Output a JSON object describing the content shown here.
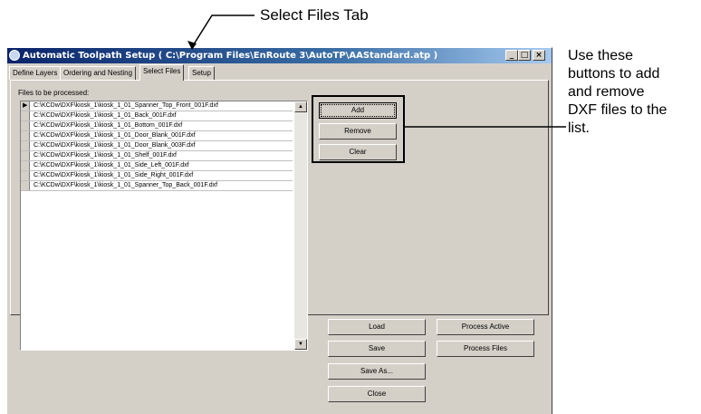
{
  "annotations": {
    "select_files_tab": "Select Files Tab",
    "buttons_note_lines": [
      "Use these",
      "buttons to add",
      "and remove",
      "DXF files to the",
      "list."
    ]
  },
  "window": {
    "title": "Automatic Toolpath Setup ( C:\\Program Files\\EnRoute 3\\AutoTP\\AAStandard.atp )",
    "controls": {
      "minimize": "_",
      "maximize": "□",
      "close": "×"
    }
  },
  "tabs": [
    {
      "label": "Define Layers",
      "active": false
    },
    {
      "label": "Ordering and Nesting",
      "active": false
    },
    {
      "label": "Select Files",
      "active": true
    },
    {
      "label": "Setup",
      "active": false
    }
  ],
  "files_label": "Files to be processed:",
  "files": [
    "C:\\KCDw\\DXF\\kiosk_1\\kiosk_1_01_Spanner_Top_Front_001F.dxf",
    "C:\\KCDw\\DXF\\kiosk_1\\kiosk_1_01_Back_001F.dxf",
    "C:\\KCDw\\DXF\\kiosk_1\\kiosk_1_01_Bottom_001F.dxf",
    "C:\\KCDw\\DXF\\kiosk_1\\kiosk_1_01_Door_Blank_001F.dxf",
    "C:\\KCDw\\DXF\\kiosk_1\\kiosk_1_01_Door_Blank_003F.dxf",
    "C:\\KCDw\\DXF\\kiosk_1\\kiosk_1_01_Shelf_001F.dxf",
    "C:\\KCDw\\DXF\\kiosk_1\\kiosk_1_01_Side_Left_001F.dxf",
    "C:\\KCDw\\DXF\\kiosk_1\\kiosk_1_01_Side_Right_001F.dxf",
    "C:\\KCDw\\DXF\\kiosk_1\\kiosk_1_01_Spanner_Top_Back_001F.dxf"
  ],
  "file_buttons": {
    "add": "Add",
    "remove": "Remove",
    "clear": "Clear"
  },
  "bottom_buttons": {
    "load": "Load",
    "save": "Save",
    "save_as": "Save As...",
    "close": "Close",
    "process_active": "Process Active",
    "process_files": "Process Files"
  },
  "icons": {
    "row_pointer": "row-pointer-icon",
    "scroll_up": "scroll-up-icon",
    "scroll_down": "scroll-down-icon"
  }
}
